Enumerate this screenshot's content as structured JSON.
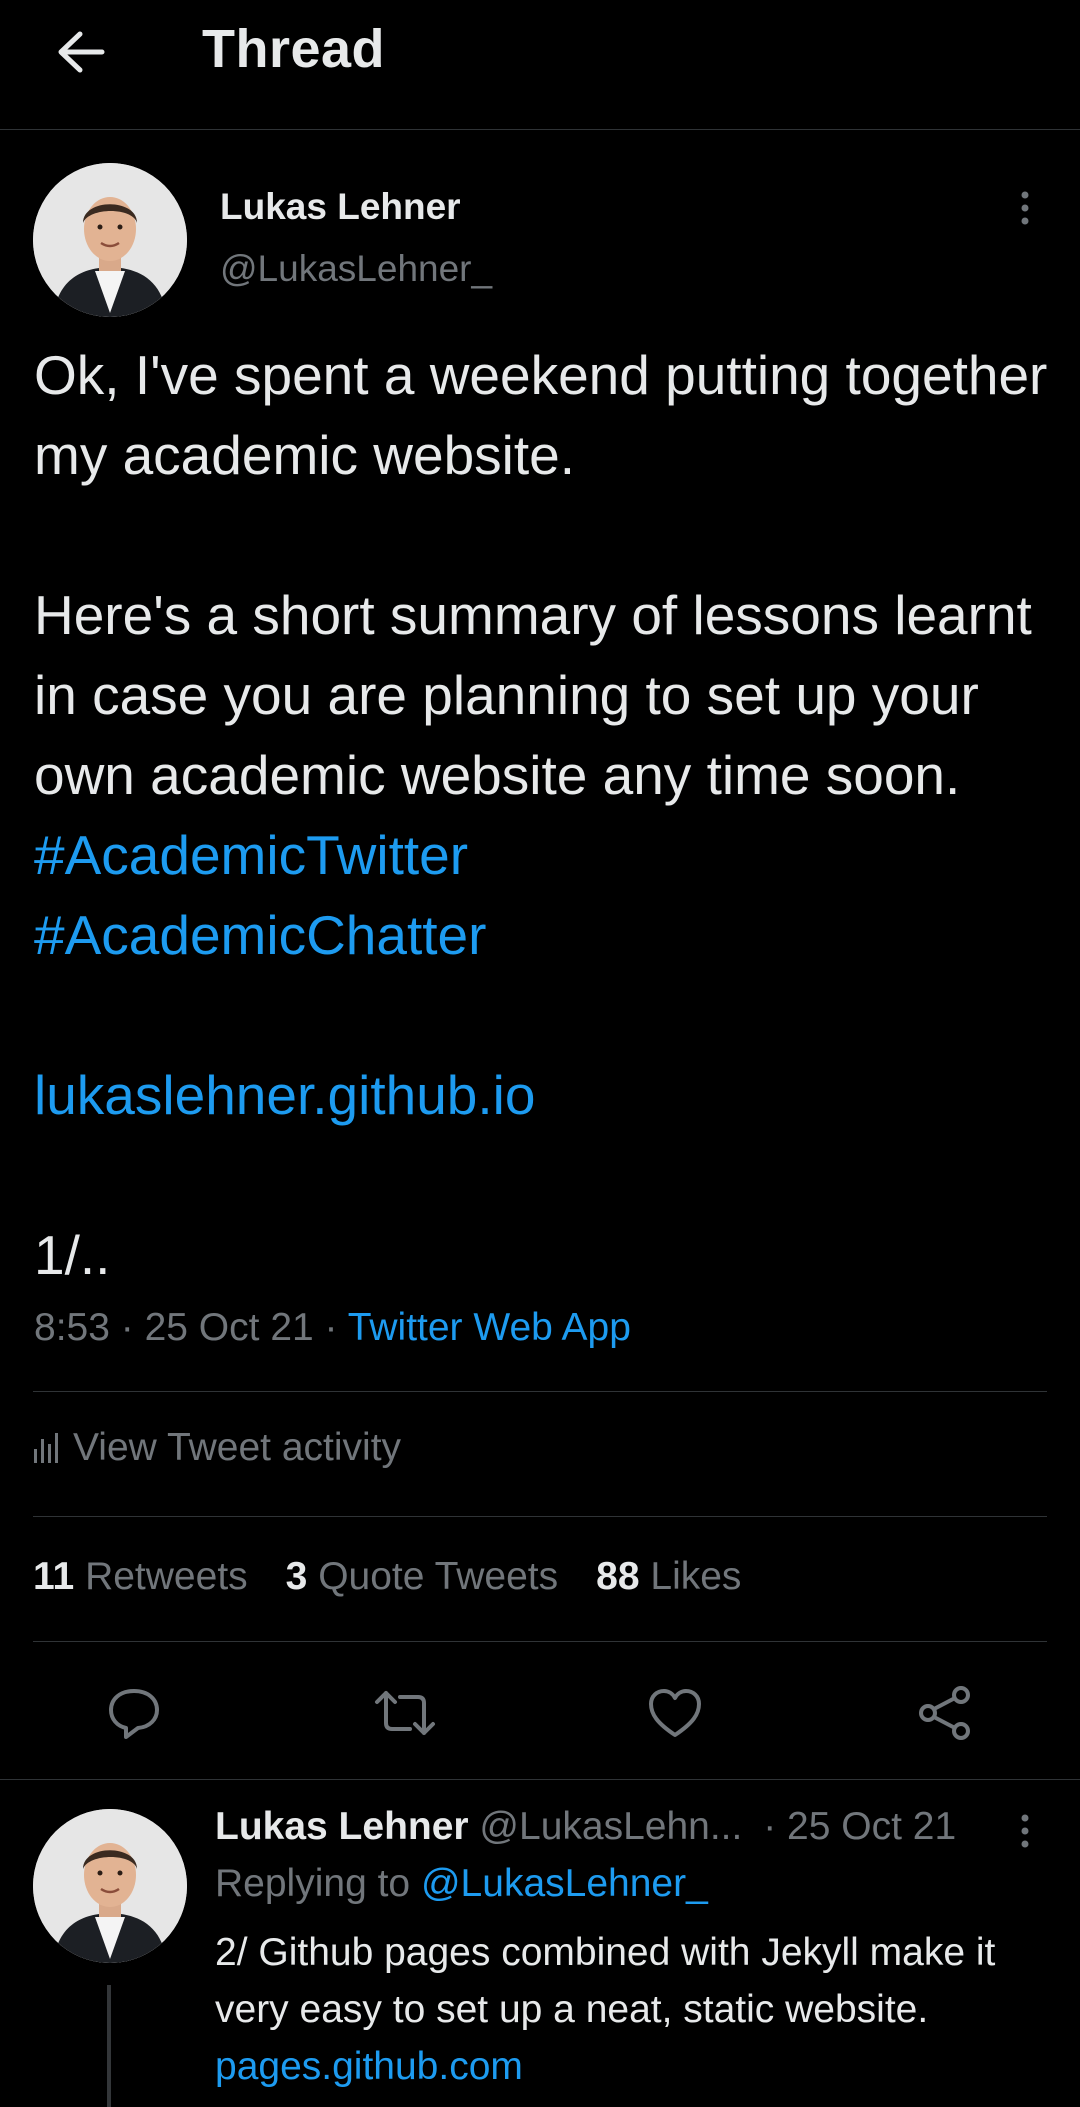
{
  "header": {
    "title": "Thread",
    "back_icon": "arrow-left-icon"
  },
  "tweet": {
    "author_name": "Lukas Lehner",
    "author_handle": "@LukasLehner_",
    "paragraph1": "Ok, I've spent a weekend putting together my academic website.",
    "paragraph2_text": "Here's a short summary of lessons learnt in case you are planning to set up your own academic website any time soon.",
    "hashtag1": "#AcademicTwitter",
    "hashtag2": "#AcademicChatter",
    "link": "lukaslehner.github.io",
    "counter": "1/..",
    "time": "8:53",
    "date": "25 Oct 21",
    "separator": "·",
    "source": "Twitter Web App",
    "activity_label": "View Tweet activity",
    "retweets_count": "11",
    "retweets_label": "Retweets",
    "quotes_count": "3",
    "quotes_label": "Quote Tweets",
    "likes_count": "88",
    "likes_label": "Likes"
  },
  "reply": {
    "author_name": "Lukas Lehner",
    "author_handle": "@LukasLehn...",
    "date_text": "· 25 Oct 21",
    "replying_prefix": "Replying to",
    "replying_to": "@LukasLehner_",
    "body": "2/ Github pages combined with Jekyll make it very easy to set up a neat, static website.",
    "link": "pages.github.com"
  },
  "colors": {
    "background": "#000000",
    "text": "#e7e9ea",
    "muted": "#71767b",
    "accent": "#1d9bf0",
    "divider": "#2f3336"
  }
}
